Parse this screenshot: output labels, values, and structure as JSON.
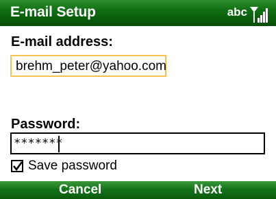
{
  "window": {
    "title": "E-mail Setup",
    "input_mode": "abc",
    "signal_icon": "signal-strength-icon"
  },
  "form": {
    "email_label": "E-mail address:",
    "email_value": "brehm_peter@yahoo.com",
    "password_label": "Password:",
    "password_value": "*******",
    "save_password_label": "Save password",
    "save_password_checked": true
  },
  "softkeys": {
    "left": "Cancel",
    "right": "Next"
  },
  "colors": {
    "title_bar": "#0e6b10",
    "focus_border": "#f6c24a"
  }
}
